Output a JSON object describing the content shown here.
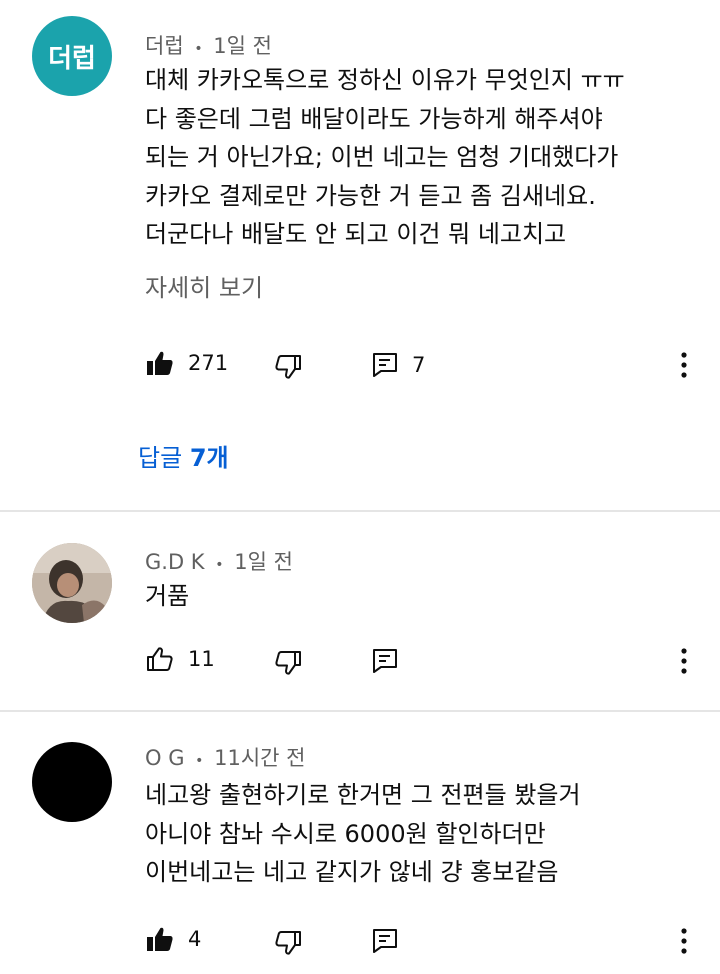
{
  "comments": [
    {
      "author": "더럽",
      "time": "1일 전",
      "avatar_text": "더럽",
      "avatar_color": "#1ba3ac",
      "lines": [
        "대체 카카오톡으로 정하신 이유가 무엇인지 ㅠㅠ",
        "다 좋은데 그럼 배달이라도 가능하게 해주셔야",
        "되는 거 아닌가요; 이번 네고는 엄청 기대했다가",
        "카카오 결제로만 가능한 거 듣고 좀 김새네요.",
        "더군다나 배달도 안 되고 이건 뭐 네고치고"
      ],
      "read_more": "자세히 보기",
      "likes": "271",
      "liked": true,
      "reply_count": "7",
      "replies_label": "답글",
      "replies_count_label": "7개"
    },
    {
      "author": "G.D K",
      "time": "1일 전",
      "lines": [
        "거품"
      ],
      "likes": "11",
      "liked": false
    },
    {
      "author": "O G",
      "time": "11시간 전",
      "lines": [
        "네고왕 출현하기로 한거면 그 전편들 봤을거",
        "아니야 참놔 수시로 6000원 할인하더만",
        "이번네고는 네고 같지가 않네 걍 홍보같음"
      ],
      "likes": "4",
      "liked": true
    }
  ],
  "icons": {
    "like": "thumbs-up-icon",
    "dislike": "thumbs-down-icon",
    "reply": "comment-icon",
    "more": "more-vert-icon"
  },
  "meta_separator": "•",
  "colors": {
    "link": "#065fd4",
    "secondary_text": "#606060",
    "divider": "#e5e5e5"
  }
}
